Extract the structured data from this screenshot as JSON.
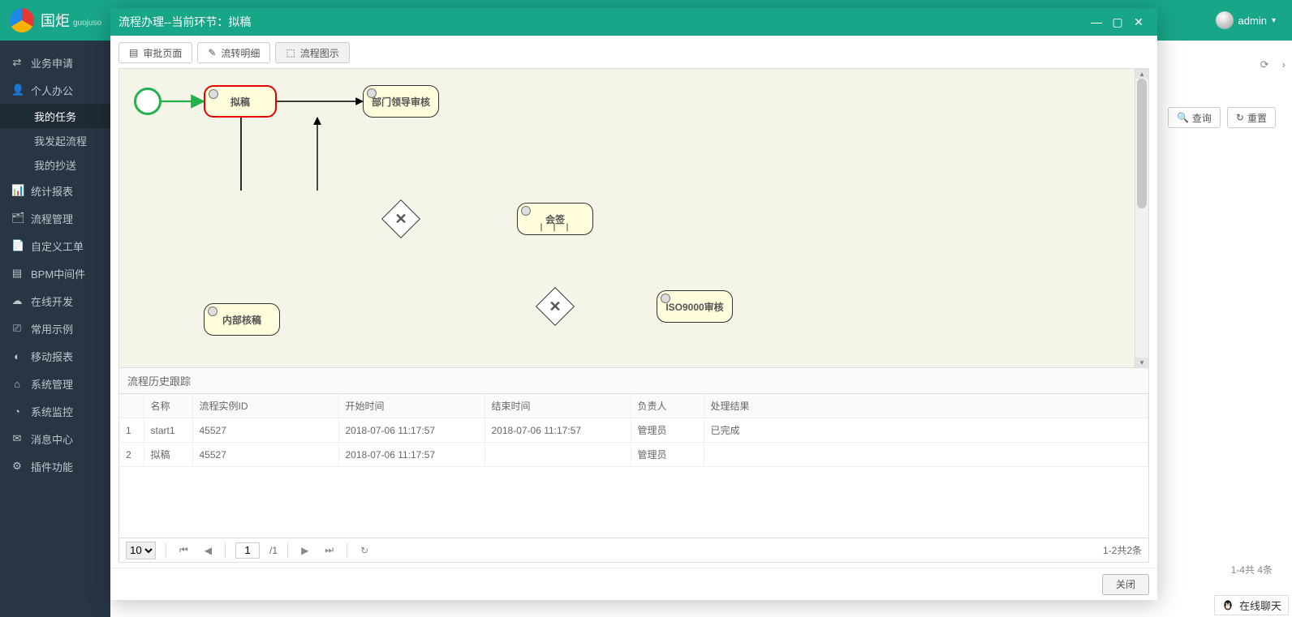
{
  "brand": {
    "name": "国炬",
    "sub": "guojuso"
  },
  "user": {
    "name": "admin"
  },
  "sidebar": {
    "items": [
      {
        "icon": "⇄",
        "label": "业务申请"
      },
      {
        "icon": "👤",
        "label": "个人办公",
        "children": [
          {
            "label": "我的任务",
            "active": true
          },
          {
            "label": "我发起流程"
          },
          {
            "label": "我的抄送"
          }
        ]
      },
      {
        "icon": "📊",
        "label": "统计报表"
      },
      {
        "icon": "🗂",
        "label": "流程管理"
      },
      {
        "icon": "📄",
        "label": "自定义工单"
      },
      {
        "icon": "▤",
        "label": "BPM中间件"
      },
      {
        "icon": "☁",
        "label": "在线开发"
      },
      {
        "icon": "⎚",
        "label": "常用示例"
      },
      {
        "icon": "◐",
        "label": "移动报表"
      },
      {
        "icon": "⌂",
        "label": "系统管理"
      },
      {
        "icon": "◔",
        "label": "系统监控"
      },
      {
        "icon": "✉",
        "label": "消息中心"
      },
      {
        "icon": "⚙",
        "label": "插件功能"
      }
    ]
  },
  "main": {
    "actions": {
      "refresh": "⟳",
      "more": "›"
    },
    "toolbar": {
      "search": "查询",
      "reset": "重置"
    },
    "footer": "1-4共 4条"
  },
  "modal": {
    "title": "流程办理--当前环节：拟稿",
    "tabs": [
      {
        "icon": "▤",
        "label": "审批页面"
      },
      {
        "icon": "✎",
        "label": "流转明细"
      },
      {
        "icon": "⬚",
        "label": "流程图示",
        "active": true
      }
    ],
    "diagram": {
      "nodes": {
        "start": {
          "type": "start"
        },
        "n_draft": {
          "label": "拟稿",
          "current": true
        },
        "n_dept": {
          "label": "部门领导审核"
        },
        "n_sign": {
          "label": "会签",
          "bars": "| | |"
        },
        "n_inner": {
          "label": "内部核稿"
        },
        "n_iso": {
          "label": "ISO9000审核"
        }
      }
    },
    "history": {
      "title": "流程历史跟踪",
      "columns": [
        "",
        "名称",
        "流程实例ID",
        "开始时间",
        "结束时间",
        "负责人",
        "处理结果"
      ],
      "rows": [
        {
          "idx": "1",
          "name": "start1",
          "pid": "45527",
          "start": "2018-07-06 11:17:57",
          "end": "2018-07-06 11:17:57",
          "owner": "管理员",
          "result": "已完成"
        },
        {
          "idx": "2",
          "name": "拟稿",
          "pid": "45527",
          "start": "2018-07-06 11:17:57",
          "end": "",
          "owner": "管理员",
          "result": ""
        }
      ]
    },
    "pager": {
      "size": "10",
      "page": "1",
      "pages": "/1",
      "summary": "1-2共2条"
    },
    "footer": {
      "close": "关闭"
    }
  },
  "chat": {
    "label": "在线聊天"
  }
}
